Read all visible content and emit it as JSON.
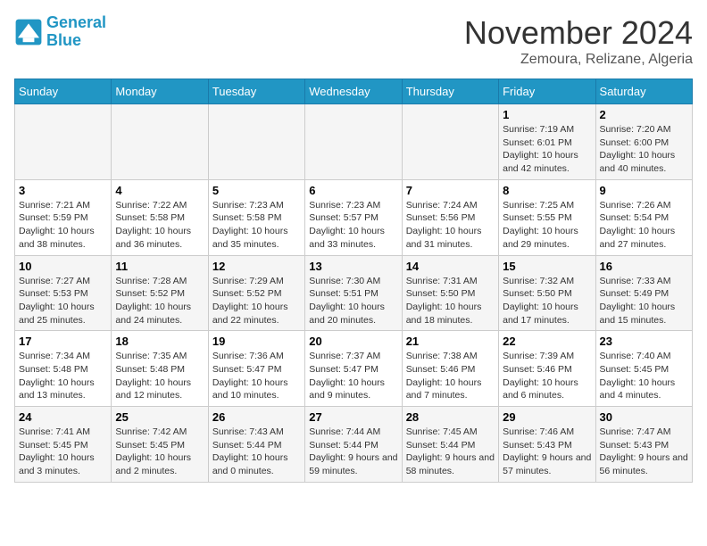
{
  "header": {
    "logo_line1": "General",
    "logo_line2": "Blue",
    "month_title": "November 2024",
    "location": "Zemoura, Relizane, Algeria"
  },
  "days_of_week": [
    "Sunday",
    "Monday",
    "Tuesday",
    "Wednesday",
    "Thursday",
    "Friday",
    "Saturday"
  ],
  "weeks": [
    [
      {
        "day": "",
        "info": ""
      },
      {
        "day": "",
        "info": ""
      },
      {
        "day": "",
        "info": ""
      },
      {
        "day": "",
        "info": ""
      },
      {
        "day": "",
        "info": ""
      },
      {
        "day": "1",
        "info": "Sunrise: 7:19 AM\nSunset: 6:01 PM\nDaylight: 10 hours and 42 minutes."
      },
      {
        "day": "2",
        "info": "Sunrise: 7:20 AM\nSunset: 6:00 PM\nDaylight: 10 hours and 40 minutes."
      }
    ],
    [
      {
        "day": "3",
        "info": "Sunrise: 7:21 AM\nSunset: 5:59 PM\nDaylight: 10 hours and 38 minutes."
      },
      {
        "day": "4",
        "info": "Sunrise: 7:22 AM\nSunset: 5:58 PM\nDaylight: 10 hours and 36 minutes."
      },
      {
        "day": "5",
        "info": "Sunrise: 7:23 AM\nSunset: 5:58 PM\nDaylight: 10 hours and 35 minutes."
      },
      {
        "day": "6",
        "info": "Sunrise: 7:23 AM\nSunset: 5:57 PM\nDaylight: 10 hours and 33 minutes."
      },
      {
        "day": "7",
        "info": "Sunrise: 7:24 AM\nSunset: 5:56 PM\nDaylight: 10 hours and 31 minutes."
      },
      {
        "day": "8",
        "info": "Sunrise: 7:25 AM\nSunset: 5:55 PM\nDaylight: 10 hours and 29 minutes."
      },
      {
        "day": "9",
        "info": "Sunrise: 7:26 AM\nSunset: 5:54 PM\nDaylight: 10 hours and 27 minutes."
      }
    ],
    [
      {
        "day": "10",
        "info": "Sunrise: 7:27 AM\nSunset: 5:53 PM\nDaylight: 10 hours and 25 minutes."
      },
      {
        "day": "11",
        "info": "Sunrise: 7:28 AM\nSunset: 5:52 PM\nDaylight: 10 hours and 24 minutes."
      },
      {
        "day": "12",
        "info": "Sunrise: 7:29 AM\nSunset: 5:52 PM\nDaylight: 10 hours and 22 minutes."
      },
      {
        "day": "13",
        "info": "Sunrise: 7:30 AM\nSunset: 5:51 PM\nDaylight: 10 hours and 20 minutes."
      },
      {
        "day": "14",
        "info": "Sunrise: 7:31 AM\nSunset: 5:50 PM\nDaylight: 10 hours and 18 minutes."
      },
      {
        "day": "15",
        "info": "Sunrise: 7:32 AM\nSunset: 5:50 PM\nDaylight: 10 hours and 17 minutes."
      },
      {
        "day": "16",
        "info": "Sunrise: 7:33 AM\nSunset: 5:49 PM\nDaylight: 10 hours and 15 minutes."
      }
    ],
    [
      {
        "day": "17",
        "info": "Sunrise: 7:34 AM\nSunset: 5:48 PM\nDaylight: 10 hours and 13 minutes."
      },
      {
        "day": "18",
        "info": "Sunrise: 7:35 AM\nSunset: 5:48 PM\nDaylight: 10 hours and 12 minutes."
      },
      {
        "day": "19",
        "info": "Sunrise: 7:36 AM\nSunset: 5:47 PM\nDaylight: 10 hours and 10 minutes."
      },
      {
        "day": "20",
        "info": "Sunrise: 7:37 AM\nSunset: 5:47 PM\nDaylight: 10 hours and 9 minutes."
      },
      {
        "day": "21",
        "info": "Sunrise: 7:38 AM\nSunset: 5:46 PM\nDaylight: 10 hours and 7 minutes."
      },
      {
        "day": "22",
        "info": "Sunrise: 7:39 AM\nSunset: 5:46 PM\nDaylight: 10 hours and 6 minutes."
      },
      {
        "day": "23",
        "info": "Sunrise: 7:40 AM\nSunset: 5:45 PM\nDaylight: 10 hours and 4 minutes."
      }
    ],
    [
      {
        "day": "24",
        "info": "Sunrise: 7:41 AM\nSunset: 5:45 PM\nDaylight: 10 hours and 3 minutes."
      },
      {
        "day": "25",
        "info": "Sunrise: 7:42 AM\nSunset: 5:45 PM\nDaylight: 10 hours and 2 minutes."
      },
      {
        "day": "26",
        "info": "Sunrise: 7:43 AM\nSunset: 5:44 PM\nDaylight: 10 hours and 0 minutes."
      },
      {
        "day": "27",
        "info": "Sunrise: 7:44 AM\nSunset: 5:44 PM\nDaylight: 9 hours and 59 minutes."
      },
      {
        "day": "28",
        "info": "Sunrise: 7:45 AM\nSunset: 5:44 PM\nDaylight: 9 hours and 58 minutes."
      },
      {
        "day": "29",
        "info": "Sunrise: 7:46 AM\nSunset: 5:43 PM\nDaylight: 9 hours and 57 minutes."
      },
      {
        "day": "30",
        "info": "Sunrise: 7:47 AM\nSunset: 5:43 PM\nDaylight: 9 hours and 56 minutes."
      }
    ]
  ]
}
